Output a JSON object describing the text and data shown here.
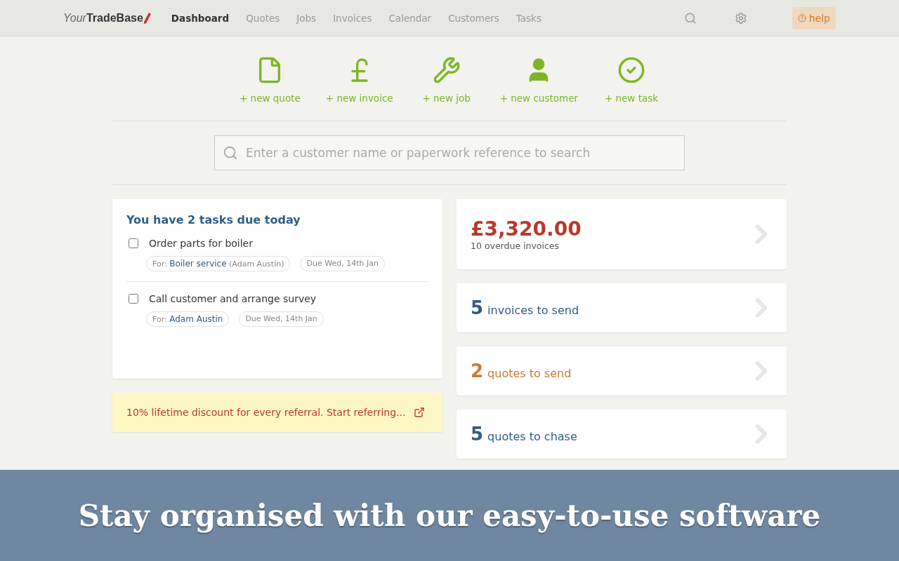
{
  "nav": {
    "logo": {
      "part1": "Your",
      "part2": "TradeBase"
    },
    "items": [
      {
        "label": "Dashboard",
        "selected": true
      },
      {
        "label": "Quotes",
        "selected": false
      },
      {
        "label": "Jobs",
        "selected": false
      },
      {
        "label": "Invoices",
        "selected": false
      },
      {
        "label": "Calendar",
        "selected": false
      },
      {
        "label": "Customers",
        "selected": false
      },
      {
        "label": "Tasks",
        "selected": false
      }
    ],
    "help": "help"
  },
  "quick_actions": [
    {
      "kind": "quote",
      "label": "+ new quote"
    },
    {
      "kind": "invoice",
      "label": "+ new invoice"
    },
    {
      "kind": "job",
      "label": "+ new job"
    },
    {
      "kind": "customer",
      "label": "+ new customer"
    },
    {
      "kind": "task",
      "label": "+ new task"
    }
  ],
  "search": {
    "placeholder": "Enter a customer name or paperwork reference to search"
  },
  "tasks": {
    "title": "You have 2 tasks due today",
    "items": [
      {
        "title": "Order parts for boiler",
        "checked": false,
        "for_label": "For:",
        "for_link": "Boiler service",
        "for_extra": "(Adam Austin)",
        "due": "Due Wed, 14th Jan"
      },
      {
        "title": "Call customer and arrange survey",
        "checked": false,
        "for_label": "For:",
        "for_link": "Adam Austin",
        "due": "Due Wed, 14th Jan"
      }
    ]
  },
  "referral": {
    "text": "10% lifetime discount for every referral. Start referring..."
  },
  "stats": [
    {
      "kind": "amount",
      "value": "£3,320.00",
      "caption": "10 overdue invoices",
      "color": "#b83a2c"
    },
    {
      "kind": "count",
      "value": "5",
      "caption": "invoices to send",
      "color": "#2f5d8a"
    },
    {
      "kind": "count",
      "value": "2",
      "caption": "quotes to send",
      "color": "#cc7a36"
    },
    {
      "kind": "count",
      "value": "5",
      "caption": "quotes to chase",
      "color": "#2f5d8a"
    }
  ],
  "banner": {
    "text": "Stay organised with our easy-to-use software"
  }
}
